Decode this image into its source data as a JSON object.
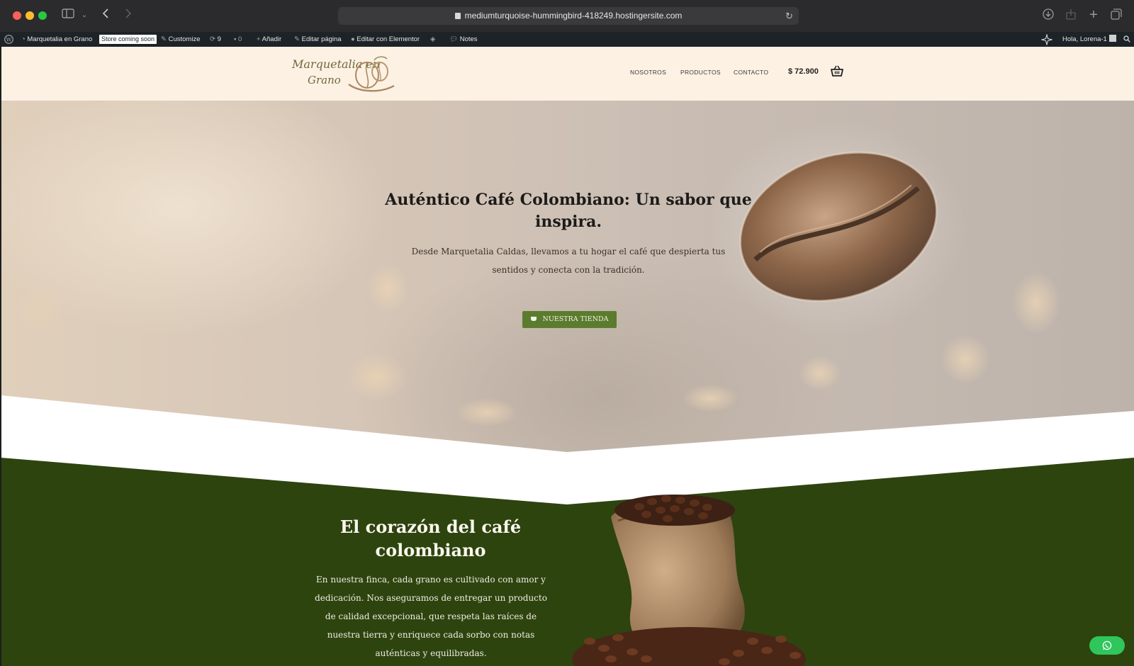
{
  "browser": {
    "url": "mediumturquoise-hummingbird-418249.hostingersite.com"
  },
  "admin_bar": {
    "site_name": "Marquetalia en Grano",
    "store_badge": "Store coming soon",
    "customize": "Customize",
    "updates_count": "9",
    "comments_count": "0",
    "add_new": "Añadir",
    "edit_page": "Editar página",
    "edit_elementor": "Editar con Elementor",
    "notes": "Notes",
    "greeting": "Hola, Lorena-1"
  },
  "header": {
    "logo_line1": "Marquetalia en",
    "logo_line2": "Grano",
    "nav": [
      "NOSOTROS",
      "PRODUCTOS",
      "CONTACTO"
    ],
    "cart_total": "$ 72.900"
  },
  "hero": {
    "title": "Auténtico Café Colombiano: Un sabor que inspira.",
    "subtitle": "Desde Marquetalia Caldas, llevamos a tu hogar el café que despierta tus sentidos y conecta con la tradición.",
    "button": "NUESTRA TIENDA"
  },
  "about": {
    "title": "El corazón del café colombiano",
    "text": "En nuestra finca, cada grano es cultivado con amor y dedicación. Nos aseguramos de entregar un producto de calidad excepcional, que respeta las raíces de nuestra tierra y enriquece cada sorbo con notas auténticas y equilibradas."
  },
  "colors": {
    "header_bg": "#fdf1e4",
    "green_section": "#2d440f",
    "button_green": "#5b7c2f",
    "whatsapp": "#2fc65b"
  }
}
